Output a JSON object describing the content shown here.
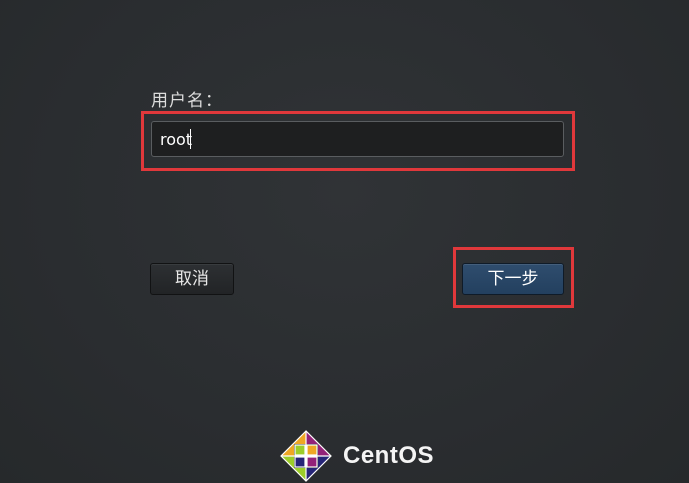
{
  "form": {
    "username_label": "用户名：",
    "username_value": "root",
    "username_placeholder": ""
  },
  "buttons": {
    "cancel_label": "取消",
    "next_label": "下一步"
  },
  "brand": {
    "name": "CentOS",
    "logo_icon": "centos-logo-icon"
  },
  "colors": {
    "background": "#2a2d30",
    "highlight": "#e0383b",
    "next_button": "#2f4d6e",
    "logo_green": "#8bc34a",
    "logo_purple": "#932279",
    "logo_orange": "#efa724",
    "logo_blue": "#262577"
  }
}
